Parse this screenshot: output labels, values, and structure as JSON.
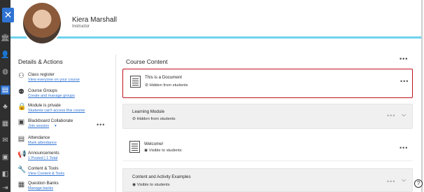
{
  "sidebar": {
    "close_icon": "close-icon"
  },
  "profile": {
    "name": "Kiera Marshall",
    "role": "Instructor"
  },
  "details": {
    "heading": "Details & Actions",
    "items": [
      {
        "title": "Class register",
        "link": "View everyone on your course",
        "icon": "users-icon"
      },
      {
        "title": "Course Groups",
        "link": "Create and manage groups",
        "icon": "groups-icon"
      },
      {
        "title": "Module is private",
        "link": "Students can't access this course",
        "icon": "lock-icon"
      },
      {
        "title": "Blackboard Collaborate",
        "link": "Join session",
        "icon": "collaborate-icon"
      },
      {
        "title": "Attendance",
        "link": "Mark attendance",
        "icon": "attendance-icon"
      },
      {
        "title": "Announcements",
        "link": "1 Posted | 1 Total",
        "icon": "megaphone-icon"
      },
      {
        "title": "Content & Tools",
        "link": "View Content & Tools",
        "icon": "wrench-icon"
      },
      {
        "title": "Question Banks",
        "link": "Manage banks",
        "icon": "bank-icon"
      }
    ]
  },
  "content": {
    "heading": "Course Content",
    "items": [
      {
        "title": "This is a Document",
        "status": "Hidden from students"
      },
      {
        "title": "Learning Module",
        "status": "Hidden from students"
      },
      {
        "title": "Welcome!",
        "status": "Visible to students"
      },
      {
        "title": "Content and Activity Examples",
        "status": "Visible to students"
      }
    ]
  },
  "colors": {
    "accent": "#2f73d3",
    "highlight_border": "#c1121f",
    "header_rule": "#6fd2ee"
  }
}
